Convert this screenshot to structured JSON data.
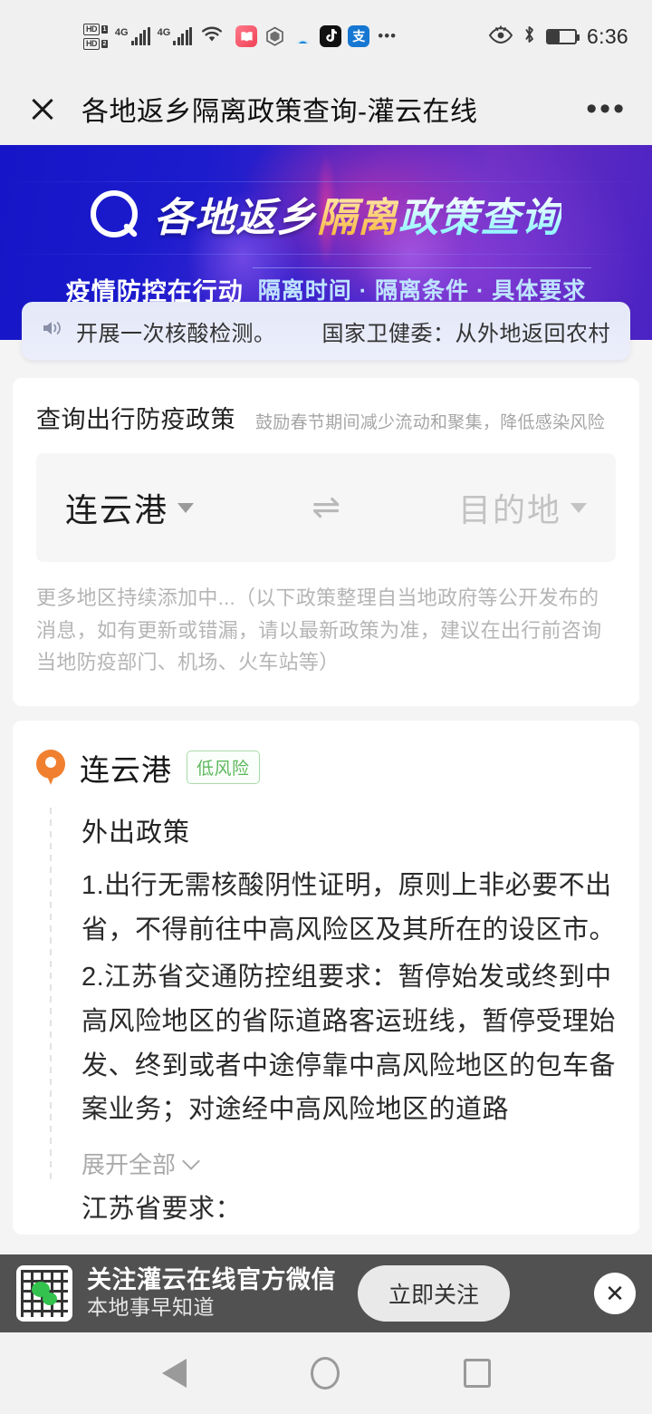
{
  "statusbar": {
    "hd_badge_1": "HD",
    "hd_sub_1": "1",
    "hd_badge_2": "HD",
    "hd_sub_2": "2",
    "net_1": "4G",
    "net_2": "4G",
    "overflow_dots": "•••",
    "time": "6:36",
    "icons": [
      "volte-hd-icon",
      "signal-4g-icon",
      "wifi-icon",
      "book-app-icon",
      "hexagon-app-icon",
      "arc-app-icon",
      "douyin-app-icon",
      "alipay-app-icon",
      "eye-comfort-icon",
      "bluetooth-icon",
      "battery-icon"
    ],
    "alipay_glyph": "支"
  },
  "titlebar": {
    "title": "各地返乡隔离政策查询-灌云在线",
    "more": "•••"
  },
  "banner": {
    "title_part1": "各地返乡",
    "title_part2": "隔离",
    "title_part3": "政策查询",
    "sub_left": "疫情防控在行动",
    "sub_right": "隔离时间 · 隔离条件 · 具体要求"
  },
  "notice": {
    "text_a": "开展一次核酸检测。",
    "text_b": "国家卫健委：从外地返回农村"
  },
  "query": {
    "title": "查询出行防疫政策",
    "subtitle": "鼓励春节期间减少流动和聚集，降低感染风险",
    "origin": "连云港",
    "destination_placeholder": "目的地",
    "swap_glyph": "⇌",
    "disclaimer": "更多地区持续添加中...（以下政策整理自当地政府等公开发布的消息，如有更新或错漏，请以最新政策为准，建议在出行前咨询当地防疫部门、机场、火车站等）"
  },
  "policy": {
    "city": "连云港",
    "risk_level": "低风险",
    "section_title": "外出政策",
    "paragraphs": [
      "1.出行无需核酸阴性证明，原则上非必要不出省，不得前往中高风险区及其所在的设区市。",
      "2.江苏省交通防控组要求：暂停始发或终到中高风险地区的省际道路客运班线，暂停受理始发、终到或者中途停靠中高风险地区的包车备案业务；对途经中高风险地区的道路"
    ],
    "expand_label": "展开全部",
    "clipped_text": "江苏省要求："
  },
  "ad": {
    "title": "关注灌云在线官方微信",
    "subtitle": "本地事早知道",
    "button": "立即关注",
    "close": "✕"
  },
  "navbar": {
    "back": "back-triangle",
    "home": "home-circle",
    "recents": "recents-square"
  },
  "colors": {
    "banner_blue": "#1616c8",
    "accent_orange": "#f08030",
    "risk_green": "#5cb85c",
    "ad_bg": "#3a3a3a"
  }
}
